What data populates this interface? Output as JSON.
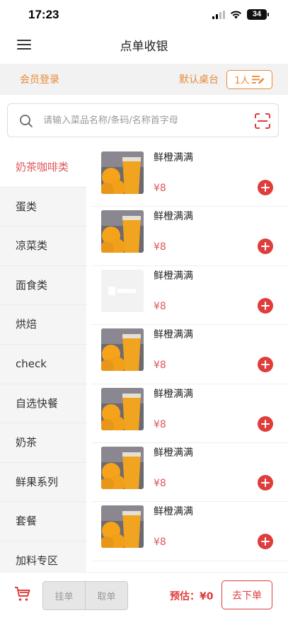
{
  "status_bar": {
    "time": "17:23",
    "battery": "34"
  },
  "nav": {
    "title": "点单收银"
  },
  "member_bar": {
    "login_label": "会员登录",
    "default_table_label": "默认桌台",
    "people_label": "1人"
  },
  "search": {
    "placeholder": "请输入菜品名称/条码/名称首字母",
    "value": ""
  },
  "categories": [
    {
      "label": "奶茶咖啡类",
      "active": true
    },
    {
      "label": "蛋类"
    },
    {
      "label": "凉菜类"
    },
    {
      "label": "面食类"
    },
    {
      "label": "烘焙"
    },
    {
      "label": "check"
    },
    {
      "label": "自选快餐"
    },
    {
      "label": "奶茶"
    },
    {
      "label": "鲜果系列"
    },
    {
      "label": "套餐"
    },
    {
      "label": "加料专区"
    }
  ],
  "products": [
    {
      "name": "鲜橙满满",
      "price": "¥8",
      "image": "orange-juice"
    },
    {
      "name": "鲜橙满满",
      "price": "¥8",
      "image": "orange-juice"
    },
    {
      "name": "鲜橙满满",
      "price": "¥8",
      "image": "placeholder"
    },
    {
      "name": "鲜橙满满",
      "price": "¥8",
      "image": "orange-juice"
    },
    {
      "name": "鲜橙满满",
      "price": "¥8",
      "image": "orange-juice"
    },
    {
      "name": "鲜橙满满",
      "price": "¥8",
      "image": "orange-juice"
    },
    {
      "name": "鲜橙满满",
      "price": "¥8",
      "image": "orange-juice"
    }
  ],
  "bottom_bar": {
    "hold_order_label": "挂单",
    "retrieve_order_label": "取单",
    "estimate_label": "预估：¥0",
    "checkout_label": "去下单"
  },
  "colors": {
    "accent": "#e03c3c",
    "orange": "#e88a3a",
    "sidebar_bg": "#f5f5f5"
  },
  "icons": [
    "menu-icon",
    "search-icon",
    "scan-icon",
    "cart-icon",
    "add-icon",
    "edit-list-icon",
    "signal-icon",
    "wifi-icon",
    "battery-icon"
  ]
}
